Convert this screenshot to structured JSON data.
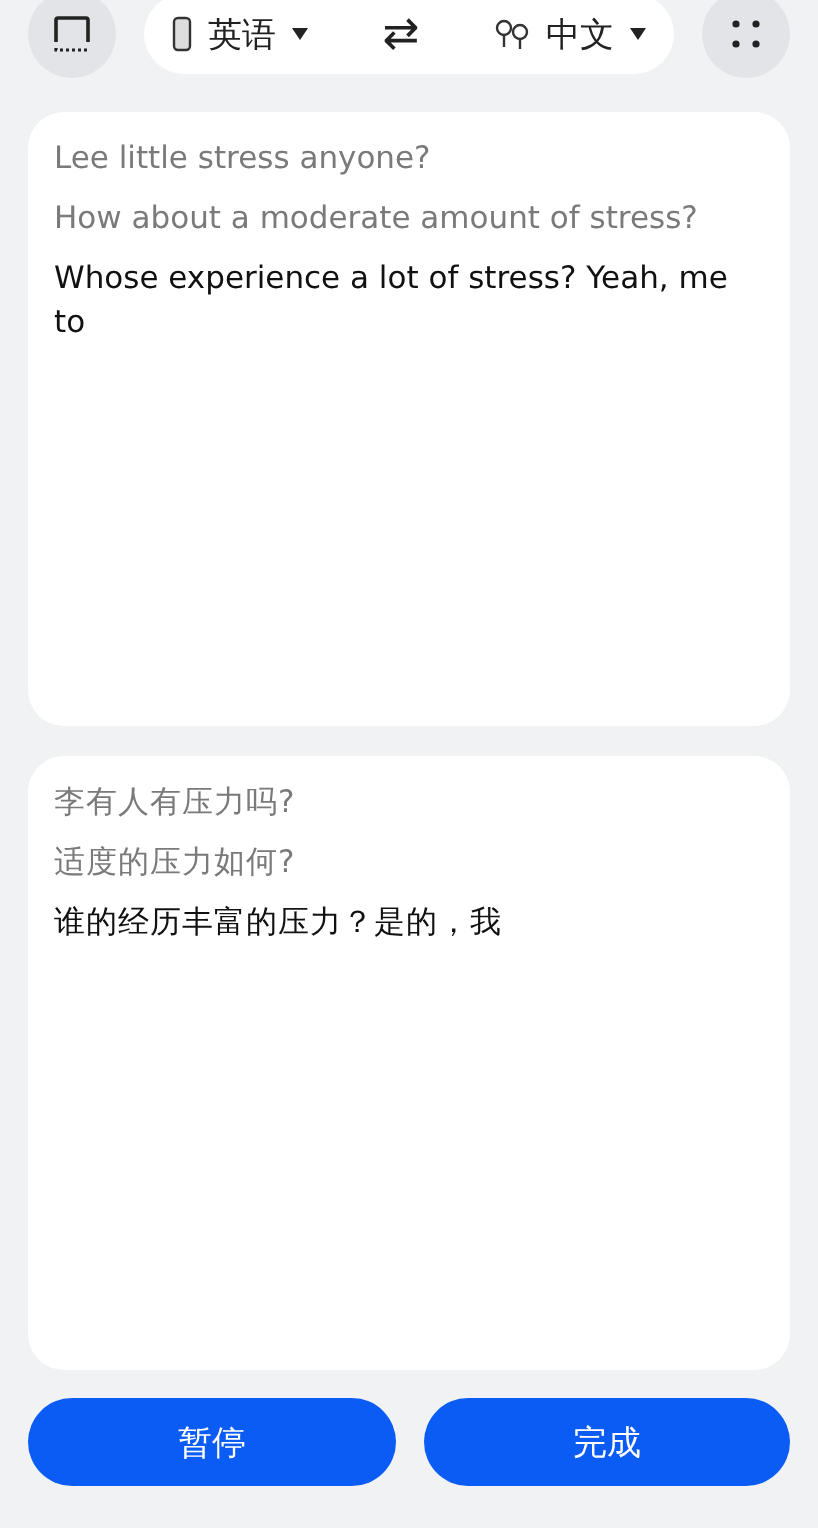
{
  "toolbar": {
    "source_language": "英语",
    "swap_label": "⇄",
    "target_language": "中文"
  },
  "source_panel": {
    "lines": [
      {
        "text": "Lee little stress anyone?",
        "current": false
      },
      {
        "text": "How about a moderate amount of stress?",
        "current": false
      },
      {
        "text": "Whose experience a lot of stress? Yeah, me to",
        "current": true
      }
    ]
  },
  "target_panel": {
    "lines": [
      {
        "text": "李有人有压力吗?",
        "current": false
      },
      {
        "text": "适度的压力如何?",
        "current": false
      },
      {
        "text": "谁的经历丰富的压力？是的，我",
        "current": true
      }
    ]
  },
  "buttons": [
    "暂停",
    "完成"
  ]
}
